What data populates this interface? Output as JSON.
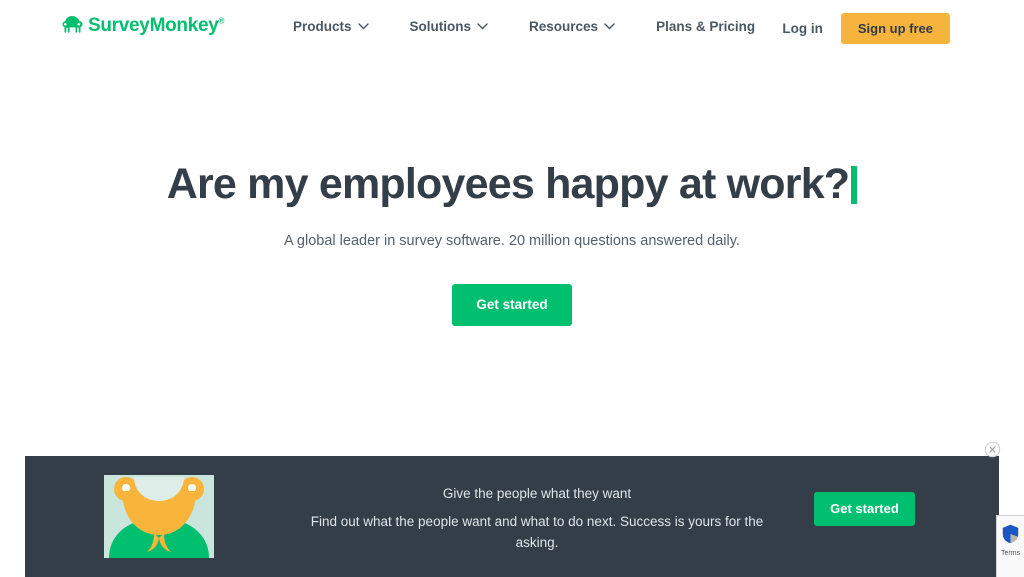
{
  "header": {
    "logo": {
      "name": "SurveyMonkey",
      "trademark": "®",
      "icon": "monkey-logo-icon",
      "color": "#00bf6f"
    },
    "nav": [
      {
        "label": "Products",
        "icon": "chevron-down-icon",
        "has_dropdown": true
      },
      {
        "label": "Solutions",
        "icon": "chevron-down-icon",
        "has_dropdown": true
      },
      {
        "label": "Resources",
        "icon": "chevron-down-icon",
        "has_dropdown": true
      },
      {
        "label": "Plans & Pricing",
        "has_dropdown": false
      }
    ],
    "login_label": "Log in",
    "signup_label": "Sign up free",
    "signup_color": "#f6b43c"
  },
  "hero": {
    "title": "Are my employees happy at work?",
    "caret_color": "#00bf6f",
    "subtitle": "A global leader in survey software. 20 million questions answered daily.",
    "cta_label": "Get started",
    "cta_color": "#00bf6f"
  },
  "banner": {
    "background": "#333e48",
    "illustration": {
      "icon": "person-with-beard-illustration",
      "bg_color": "#c9e5dc",
      "face_color": "#f9b43c",
      "body_color": "#00bf6f"
    },
    "headline": "Give the people what they want",
    "body": "Find out what the people want and what to do next. Success is yours for the asking.",
    "cta_label": "Get started",
    "cta_color": "#00bf6f",
    "close_icon": "close-circle-icon"
  },
  "recaptcha": {
    "terms_label": "Terms",
    "icon": "recaptcha-shield-icon"
  }
}
